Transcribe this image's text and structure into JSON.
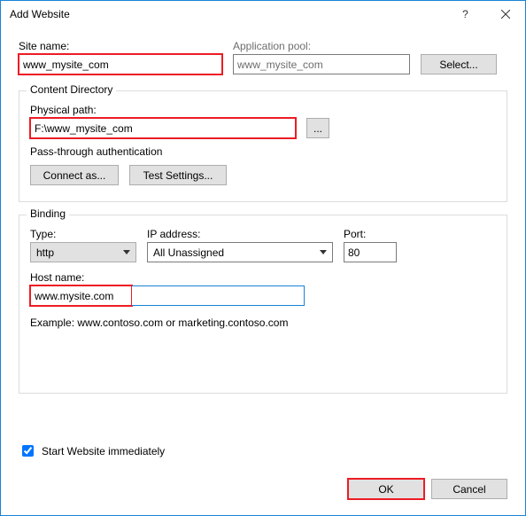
{
  "title": "Add Website",
  "site_name_label": "Site name:",
  "site_name_value": "www_mysite_com",
  "app_pool_label": "Application pool:",
  "app_pool_value": "www_mysite_com",
  "select_btn": "Select...",
  "content_directory": {
    "legend": "Content Directory",
    "physical_path_label": "Physical path:",
    "physical_path_value": "F:\\www_mysite_com",
    "browse_btn": "...",
    "passthrough_label": "Pass-through authentication",
    "connect_as_btn": "Connect as...",
    "test_settings_btn": "Test Settings..."
  },
  "binding": {
    "legend": "Binding",
    "type_label": "Type:",
    "type_value": "http",
    "ip_label": "IP address:",
    "ip_value": "All Unassigned",
    "port_label": "Port:",
    "port_value": "80",
    "host_label": "Host name:",
    "host_value": "www.mysite.com",
    "example": "Example: www.contoso.com or marketing.contoso.com"
  },
  "start_immediately_label": "Start Website immediately",
  "start_immediately_checked": true,
  "ok_btn": "OK",
  "cancel_btn": "Cancel"
}
